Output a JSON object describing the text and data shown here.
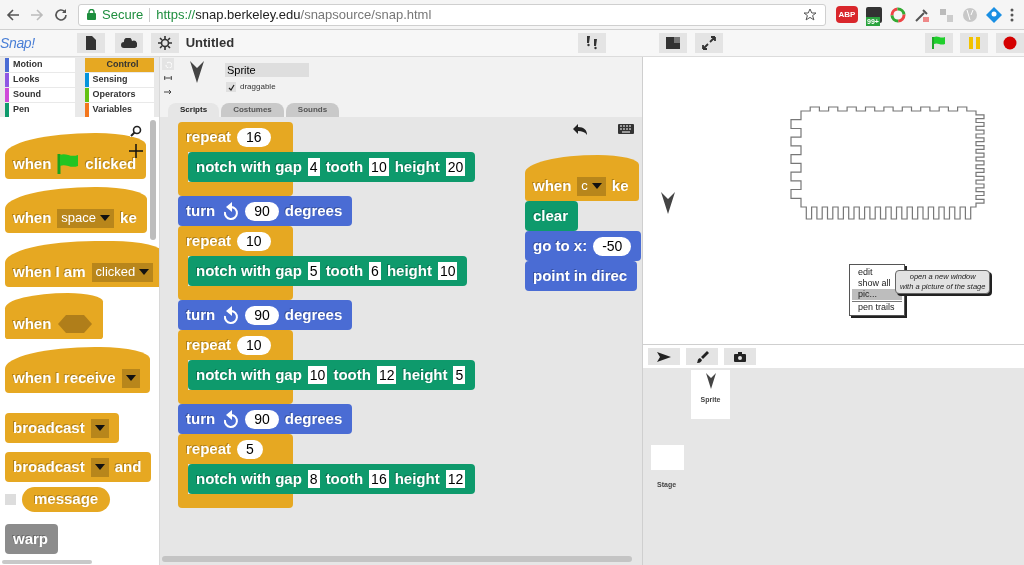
{
  "browser": {
    "secure_label": "Secure",
    "url": {
      "scheme": "https://",
      "host": "snap.berkeley.edu",
      "path": "/snapsource/snap.html"
    },
    "extensions": [
      {
        "kind": "abp",
        "text": "ABP"
      },
      {
        "kind": "badged",
        "text": "99+"
      }
    ]
  },
  "toolbar": {
    "logo": "Snap!",
    "project_title": "Untitled"
  },
  "categories": [
    {
      "label": "Motion",
      "color": "#4a6cd4",
      "selected": false
    },
    {
      "label": "Control",
      "color": "#e6a822",
      "selected": true
    },
    {
      "label": "Looks",
      "color": "#8f56e3",
      "selected": false
    },
    {
      "label": "Sensing",
      "color": "#0494dc",
      "selected": false
    },
    {
      "label": "Sound",
      "color": "#cf4ad9",
      "selected": false
    },
    {
      "label": "Operators",
      "color": "#62c213",
      "selected": false
    },
    {
      "label": "Pen",
      "color": "#0e9a6c",
      "selected": false
    },
    {
      "label": "Variables",
      "color": "#f3761d",
      "selected": false
    }
  ],
  "sprite": {
    "name": "Sprite",
    "draggable": true,
    "draggable_label": "draggable"
  },
  "tabs": [
    {
      "label": "Scripts",
      "selected": true
    },
    {
      "label": "Costumes",
      "selected": false
    },
    {
      "label": "Sounds",
      "selected": false
    }
  ],
  "palette": [
    {
      "kind": "hat",
      "color": "#e6a822",
      "parts": [
        {
          "kind": "label",
          "text": "when"
        },
        {
          "kind": "flag"
        },
        {
          "kind": "label",
          "text": "clicked"
        }
      ]
    },
    {
      "kind": "hat",
      "color": "#e6a822",
      "parts": [
        {
          "kind": "label",
          "text": "when"
        },
        {
          "kind": "dropdown",
          "text": "space"
        },
        {
          "kind": "label",
          "text": "ke"
        }
      ]
    },
    {
      "kind": "hat",
      "color": "#e6a822",
      "parts": [
        {
          "kind": "label",
          "text": "when I am"
        },
        {
          "kind": "dropdown",
          "text": "clicked"
        }
      ]
    },
    {
      "kind": "hat",
      "color": "#e6a822",
      "parts": [
        {
          "kind": "label",
          "text": "when"
        },
        {
          "kind": "boolean"
        }
      ]
    },
    {
      "kind": "hat",
      "color": "#e6a822",
      "parts": [
        {
          "kind": "label",
          "text": "when I receive"
        },
        {
          "kind": "dropdown"
        }
      ]
    },
    {
      "kind": "command",
      "color": "#e6a822",
      "parts": [
        {
          "kind": "label",
          "text": "broadcast"
        },
        {
          "kind": "dropdown"
        }
      ]
    },
    {
      "kind": "command",
      "color": "#e6a822",
      "parts": [
        {
          "kind": "label",
          "text": "broadcast"
        },
        {
          "kind": "dropdown"
        },
        {
          "kind": "label",
          "text": "and"
        }
      ]
    },
    {
      "kind": "reporter",
      "color": "#e6a822",
      "checked": false,
      "parts": [
        {
          "kind": "label",
          "text": "message"
        }
      ]
    },
    {
      "kind": "command",
      "color": "#8c8c8c",
      "parts": [
        {
          "kind": "label",
          "text": "warp"
        }
      ]
    }
  ],
  "scripts": [
    {
      "blocks": [
        {
          "kind": "c",
          "color": "#e6a822",
          "parts": [
            {
              "kind": "label",
              "text": "repeat"
            },
            {
              "kind": "number",
              "text": "16"
            }
          ],
          "children": [
            {
              "kind": "command",
              "color": "#0e9a6c",
              "parts": [
                {
                  "kind": "label",
                  "text": "notch with gap"
                },
                {
                  "kind": "box",
                  "text": "4"
                },
                {
                  "kind": "label",
                  "text": "tooth"
                },
                {
                  "kind": "box",
                  "text": "10"
                },
                {
                  "kind": "label",
                  "text": "height"
                },
                {
                  "kind": "box",
                  "text": "20"
                }
              ]
            }
          ]
        },
        {
          "kind": "command",
          "color": "#4a6cd4",
          "parts": [
            {
              "kind": "label",
              "text": "turn"
            },
            {
              "kind": "turn_left"
            },
            {
              "kind": "number",
              "text": "90"
            },
            {
              "kind": "label",
              "text": "degrees"
            }
          ]
        },
        {
          "kind": "c",
          "color": "#e6a822",
          "parts": [
            {
              "kind": "label",
              "text": "repeat"
            },
            {
              "kind": "number",
              "text": "10"
            }
          ],
          "children": [
            {
              "kind": "command",
              "color": "#0e9a6c",
              "parts": [
                {
                  "kind": "label",
                  "text": "notch with gap"
                },
                {
                  "kind": "box",
                  "text": "5"
                },
                {
                  "kind": "label",
                  "text": "tooth"
                },
                {
                  "kind": "box",
                  "text": "6"
                },
                {
                  "kind": "label",
                  "text": "height"
                },
                {
                  "kind": "box",
                  "text": "10"
                }
              ]
            }
          ]
        },
        {
          "kind": "command",
          "color": "#4a6cd4",
          "parts": [
            {
              "kind": "label",
              "text": "turn"
            },
            {
              "kind": "turn_left"
            },
            {
              "kind": "number",
              "text": "90"
            },
            {
              "kind": "label",
              "text": "degrees"
            }
          ]
        },
        {
          "kind": "c",
          "color": "#e6a822",
          "parts": [
            {
              "kind": "label",
              "text": "repeat"
            },
            {
              "kind": "number",
              "text": "10"
            }
          ],
          "children": [
            {
              "kind": "command",
              "color": "#0e9a6c",
              "parts": [
                {
                  "kind": "label",
                  "text": "notch with gap"
                },
                {
                  "kind": "box",
                  "text": "10"
                },
                {
                  "kind": "label",
                  "text": "tooth"
                },
                {
                  "kind": "box",
                  "text": "12"
                },
                {
                  "kind": "label",
                  "text": "height"
                },
                {
                  "kind": "box",
                  "text": "5"
                }
              ]
            }
          ]
        },
        {
          "kind": "command",
          "color": "#4a6cd4",
          "parts": [
            {
              "kind": "label",
              "text": "turn"
            },
            {
              "kind": "turn_left"
            },
            {
              "kind": "number",
              "text": "90"
            },
            {
              "kind": "label",
              "text": "degrees"
            }
          ]
        },
        {
          "kind": "c",
          "color": "#e6a822",
          "parts": [
            {
              "kind": "label",
              "text": "repeat"
            },
            {
              "kind": "number",
              "text": "5"
            }
          ],
          "children": [
            {
              "kind": "command",
              "color": "#0e9a6c",
              "parts": [
                {
                  "kind": "label",
                  "text": "notch with gap"
                },
                {
                  "kind": "box",
                  "text": "8"
                },
                {
                  "kind": "label",
                  "text": "tooth"
                },
                {
                  "kind": "box",
                  "text": "16"
                },
                {
                  "kind": "label",
                  "text": "height"
                },
                {
                  "kind": "box",
                  "text": "12"
                }
              ]
            }
          ]
        }
      ]
    },
    {
      "blocks": [
        {
          "kind": "hat",
          "color": "#e6a822",
          "parts": [
            {
              "kind": "label",
              "text": "when"
            },
            {
              "kind": "dropdown",
              "text": "c"
            },
            {
              "kind": "label",
              "text": "ke"
            }
          ]
        },
        {
          "kind": "command",
          "color": "#0e9a6c",
          "parts": [
            {
              "kind": "label",
              "text": "clear"
            }
          ]
        },
        {
          "kind": "command",
          "color": "#4a6cd4",
          "parts": [
            {
              "kind": "label",
              "text": "go to x:"
            },
            {
              "kind": "number",
              "text": "-50"
            }
          ]
        },
        {
          "kind": "command",
          "color": "#4a6cd4",
          "parts": [
            {
              "kind": "label",
              "text": "point in direc"
            }
          ]
        }
      ]
    }
  ],
  "context_menu": {
    "items": [
      {
        "label": "edit",
        "selected": false,
        "separated": false
      },
      {
        "label": "show all",
        "selected": false,
        "separated": false
      },
      {
        "label": "pic...",
        "selected": true,
        "separated": false
      },
      {
        "label": "pen trails",
        "selected": false,
        "separated": true
      }
    ]
  },
  "tooltip": "open a new window\nwith a picture of the stage",
  "corral": {
    "sprites": [
      {
        "name": "Sprite"
      }
    ],
    "stage": "Stage"
  }
}
